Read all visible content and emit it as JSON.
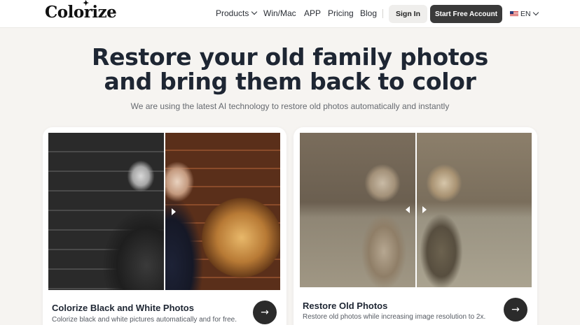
{
  "brand": {
    "name": "Colorize"
  },
  "nav": {
    "items": [
      {
        "label": "Products",
        "has_dropdown": true
      },
      {
        "label": "Win/Mac"
      },
      {
        "label": "APP"
      },
      {
        "label": "Pricing"
      },
      {
        "label": "Blog"
      }
    ],
    "sign_in": "Sign In",
    "start_free": "Start Free Account",
    "language": "EN",
    "language_flag_icon": "us-flag-icon"
  },
  "hero": {
    "title_line1": "Restore your old family photos",
    "title_line2": "and bring them back to color",
    "subtitle": "We are using the latest AI technology to restore old photos automatically and instantly"
  },
  "cards": [
    {
      "title": "Colorize Black and White Photos",
      "description": "Colorize black and white pictures automatically and for free.",
      "arrow_icon": "arrow-right-icon"
    },
    {
      "title": "Restore Old Photos",
      "description": "Restore old photos while increasing image resolution to 2x.",
      "arrow_icon": "arrow-right-icon"
    }
  ],
  "colors": {
    "page_bg": "#f6f4f1",
    "header_bg": "#ffffff",
    "primary_button": "#3a3a3a",
    "arrow_button": "#2b2b2b"
  }
}
